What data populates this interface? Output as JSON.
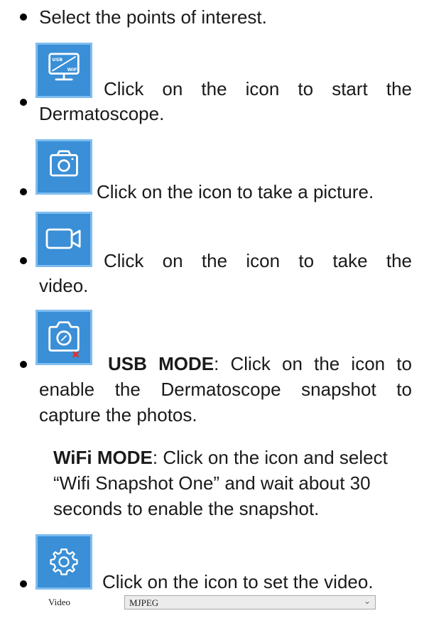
{
  "items": [
    {
      "text": "Select the points of interest."
    },
    {
      "icon": "usb-wifi-monitor-icon",
      "line1": "Click on the icon to start the",
      "line2": "Dermatoscope."
    },
    {
      "icon": "camera-icon",
      "text": "Click on the icon to take a picture."
    },
    {
      "icon": "video-camera-icon",
      "line1": "Click on the icon to take the",
      "line2": "video."
    },
    {
      "icon": "snapshot-camera-icon",
      "usb_label": "USB MODE",
      "usb_line1": ": Click on the icon to",
      "usb_line2": "enable the Dermatoscope snapshot to",
      "usb_line3": "capture the photos.",
      "wifi_label": "WiFi MODE",
      "wifi_line1": ": Click on the icon and select",
      "wifi_line2": "“Wifi Snapshot One” and wait about 30",
      "wifi_line3": "seconds  to enable the snapshot."
    },
    {
      "icon": "gear-icon",
      "text": "Click on the icon to set the video."
    }
  ],
  "icon_labels": {
    "usb": "USB",
    "wifi": "WiFi"
  },
  "video_setting": {
    "label": "Video",
    "value": "MJPEG",
    "arrow": "⌄"
  },
  "colors": {
    "icon_fill": "#3a8fd6",
    "icon_border": "#7fbdf0",
    "mark_red": "#e0302a"
  }
}
